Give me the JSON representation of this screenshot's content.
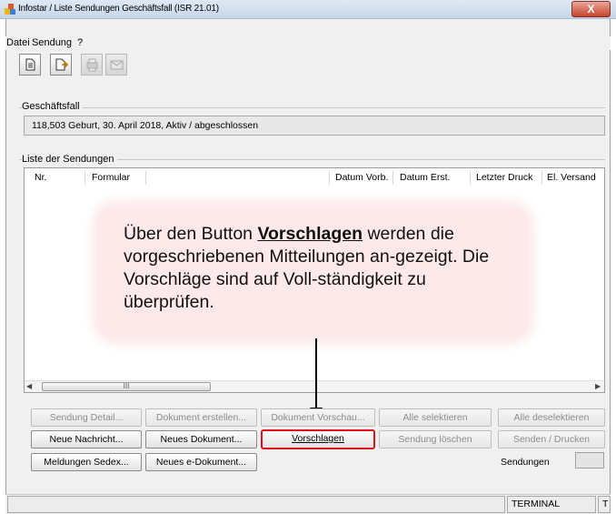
{
  "window": {
    "title": "Infostar / Liste Sendungen Geschäftsfall (ISR 21.01)",
    "close_symbol": "X"
  },
  "menu": {
    "items": [
      "Datei",
      "Sendung",
      "?"
    ]
  },
  "toolbar": {
    "buttons": [
      {
        "icon": "document-icon",
        "enabled": true
      },
      {
        "icon": "document-arrow-icon",
        "enabled": true
      },
      {
        "icon": "printer-icon",
        "enabled": false
      },
      {
        "icon": "envelope-icon",
        "enabled": false
      }
    ]
  },
  "case_group": {
    "label": "Geschäftsfall",
    "value": "118,503  Geburt, 30. April 2018, Aktiv / abgeschlossen"
  },
  "list_group": {
    "label": "Liste der Sendungen",
    "columns": [
      "Nr.",
      "Formular",
      "",
      "Datum Vorb.",
      "Datum Erst.",
      "Letzter Druck",
      "El. Versand"
    ],
    "rows": [],
    "scroll_thumb_label": "III"
  },
  "callout": {
    "text_before": "Über den Button ",
    "text_highlight": "Vorschlagen",
    "text_after": " werden die vorgeschriebenen Mitteilungen an-gezeigt. Die Vorschläge sind auf Voll-ständigkeit zu überprüfen."
  },
  "buttons": {
    "row1": [
      "Sendung Detail...",
      "Dokument erstellen...",
      "Dokument Vorschau...",
      "Alle selektieren",
      "Alle deselektieren"
    ],
    "row2": [
      "Neue Nachricht...",
      "Neues Dokument...",
      "Vorschlagen",
      "Sendung löschen",
      "Senden / Drucken"
    ],
    "row3": [
      "Meldungen Sedex...",
      "Neues e-Dokument..."
    ],
    "sendungen_label": "Sendungen"
  },
  "statusbar": {
    "cells": [
      "",
      "TERMINAL",
      "T"
    ]
  },
  "colors": {
    "highlight_border": "#e1101c",
    "callout_bg": "#fde9e9"
  }
}
